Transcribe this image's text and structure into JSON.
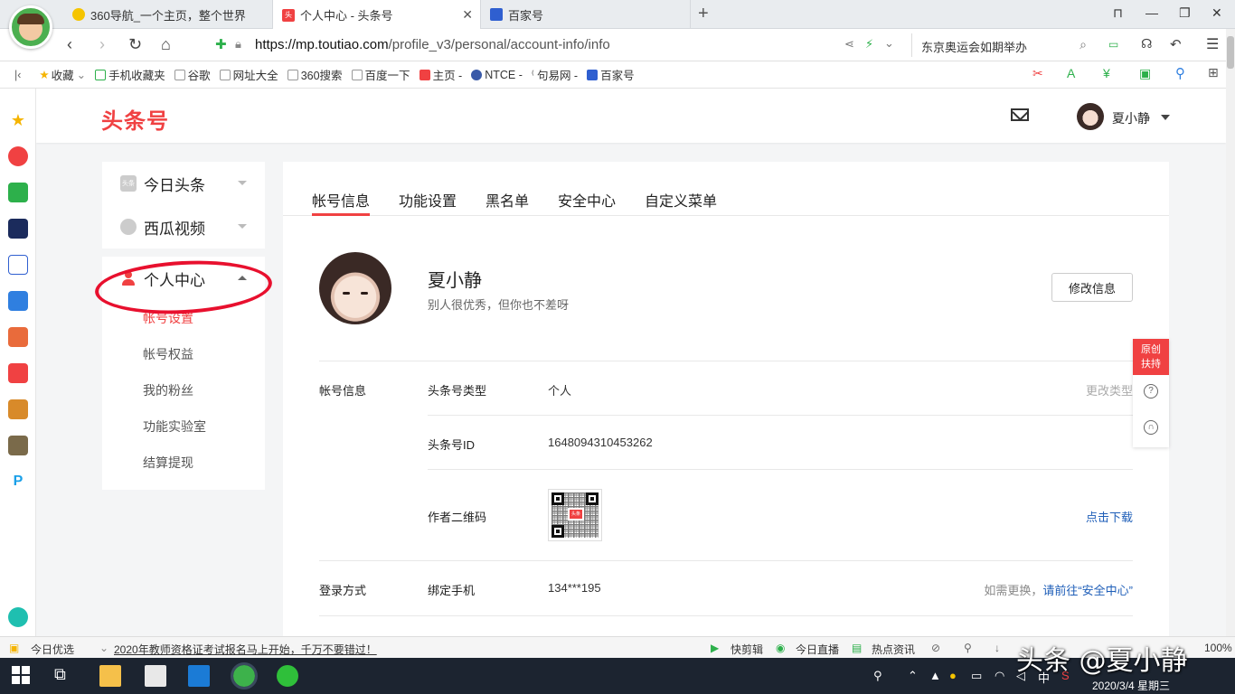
{
  "browser": {
    "tabs": [
      {
        "label": "360导航_一个主页，整个世界",
        "icon": "360-icon"
      },
      {
        "label": "个人中心 - 头条号",
        "icon": "toutiao-icon"
      },
      {
        "label": "百家号",
        "icon": "baijia-icon"
      }
    ],
    "url_host": "https://mp.toutiao.com",
    "url_path": "/profile_v3/personal/account-info/info",
    "search_text": "东京奥运会如期举办",
    "bookmarks": [
      {
        "label": "收藏"
      },
      {
        "label": "手机收藏夹"
      },
      {
        "label": "谷歌"
      },
      {
        "label": "网址大全"
      },
      {
        "label": "360搜索"
      },
      {
        "label": "百度一下"
      },
      {
        "label": "主页 -"
      },
      {
        "label": "NTCE -"
      },
      {
        "label": "句易网 -"
      },
      {
        "label": "百家号"
      }
    ]
  },
  "site": {
    "logo": "头条号",
    "username": "夏小静"
  },
  "sidenav": {
    "items": [
      {
        "label": "今日头条",
        "icon_text": "头条"
      },
      {
        "label": "西瓜视频"
      },
      {
        "label": "个人中心"
      }
    ],
    "sub_items": [
      "帐号设置",
      "帐号权益",
      "我的粉丝",
      "功能实验室",
      "结算提现"
    ]
  },
  "main": {
    "tabs": [
      "帐号信息",
      "功能设置",
      "黑名单",
      "安全中心",
      "自定义菜单"
    ],
    "profile": {
      "name": "夏小静",
      "bio": "别人很优秀，但你也不差呀",
      "edit_label": "修改信息"
    },
    "sections": {
      "account": "帐号信息",
      "login": "登录方式"
    },
    "fields": [
      {
        "label": "头条号类型",
        "value": "个人",
        "action": "更改类型"
      },
      {
        "label": "头条号ID",
        "value": "1648094310453262"
      },
      {
        "label": "作者二维码",
        "action": "点击下载",
        "qr_text": "头条"
      },
      {
        "label": "绑定手机",
        "value": "134***195",
        "action_prefix": "如需更换，",
        "action": "请前往“安全中心”"
      }
    ]
  },
  "float": {
    "badge": "原创扶持",
    "badge_line1": "原创",
    "badge_line2": "扶持"
  },
  "statusbar": {
    "left": "今日优选",
    "news": "2020年教师资格证考试报名马上开始，千万不要错过！",
    "items": [
      "快剪辑",
      "今日直播",
      "热点资讯"
    ],
    "zoom": "100%"
  },
  "watermark": "头条 @夏小静",
  "taskbar": {
    "ime": "中",
    "datetime": "2020/3/4 星期三"
  },
  "colors": {
    "brand": "#f04142",
    "link": "#1e5eb8"
  }
}
